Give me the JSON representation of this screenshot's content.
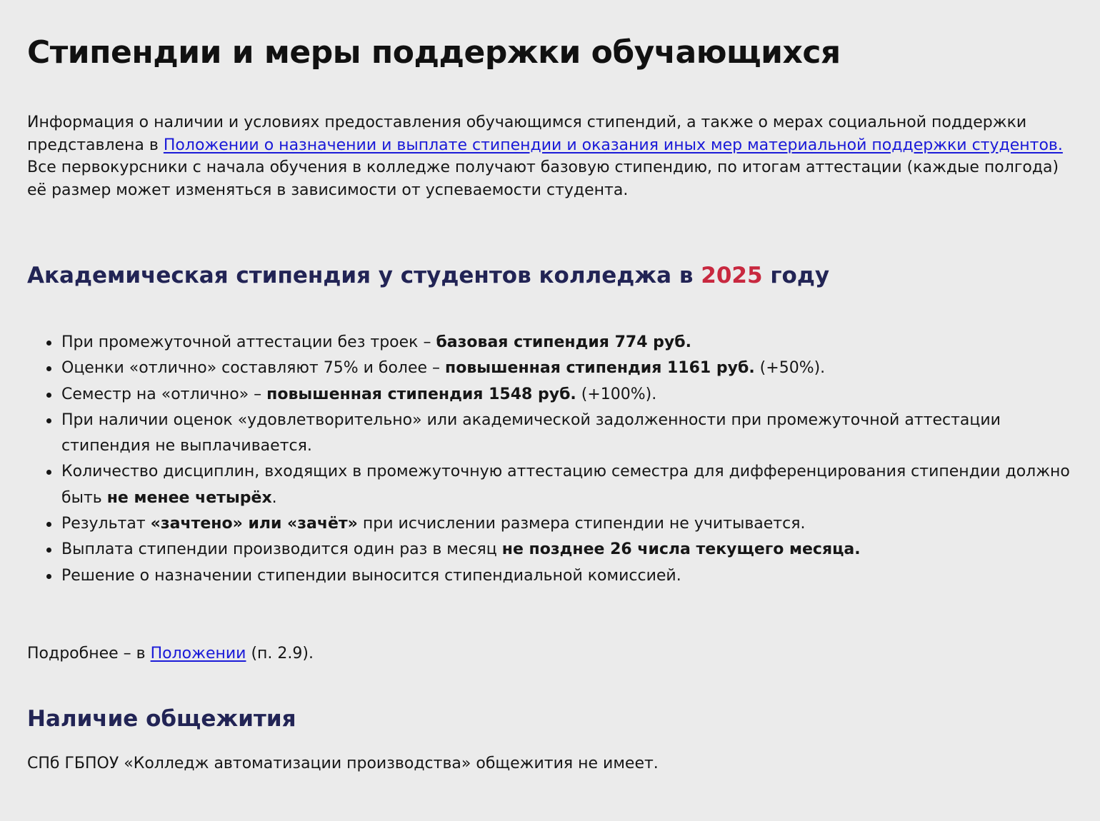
{
  "page": {
    "title": "Стипендии и меры поддержки обучающихся"
  },
  "intro": {
    "text_before_link": "Информация о наличии и условиях предоставления обучающимся стипендий, а также о мерах социальной поддержки представлена в ",
    "link_text": "Положении о назначении и выплате стипендии и оказания иных мер материальной поддержки студентов.",
    "text_after_link": " Все первокурсники с начала обучения в колледже получают базовую стипендию, по итогам аттестации (каждые полгода) её размер может изменяться в зависимости от успеваемости студента."
  },
  "academic": {
    "heading_before": "Академическая стипендия у студентов колледжа в ",
    "year": "2025",
    "heading_after": " году",
    "accent_color": "#c8283f",
    "items": [
      {
        "before": "При промежуточной аттестации без троек – ",
        "bold": "базовая стипендия 774 руб.",
        "after": ""
      },
      {
        "before": "Оценки «отлично» составляют 75% и более – ",
        "bold": "повышенная стипендия 1161 руб.",
        "after": " (+50%)."
      },
      {
        "before": "Семестр на «отлично» – ",
        "bold": "повышенная стипендия 1548 руб.",
        "after": " (+100%)."
      },
      {
        "before": "При наличии оценок «удовлетворительно» или академической задолженности при промежуточной аттестации стипендия не выплачивается.",
        "bold": "",
        "after": ""
      },
      {
        "before": "Количество дисциплин, входящих в промежуточную аттестацию семестра для дифференцирования стипендии должно быть ",
        "bold": "не менее четырёх",
        "after": "."
      },
      {
        "before": "Результат ",
        "bold": "«зачтено» или «зачёт»",
        "after": " при исчислении размера стипендии не учитывается."
      },
      {
        "before": "Выплата стипендии производится один раз в месяц ",
        "bold": "не позднее 26 числа текущего месяца.",
        "after": ""
      },
      {
        "before": "Решение о назначении стипендии выносится стипендиальной комиссией.",
        "bold": "",
        "after": ""
      }
    ]
  },
  "more": {
    "before": "Подробнее – в ",
    "link_text": "Положении",
    "after": " (п. 2.9)."
  },
  "dorm": {
    "heading": "Наличие общежития",
    "text": "СПб ГБПОУ «Колледж автоматизации производства» общежития не имеет."
  },
  "colors": {
    "heading": "#222455",
    "link": "#1a1ad8",
    "background": "#ebebeb"
  }
}
